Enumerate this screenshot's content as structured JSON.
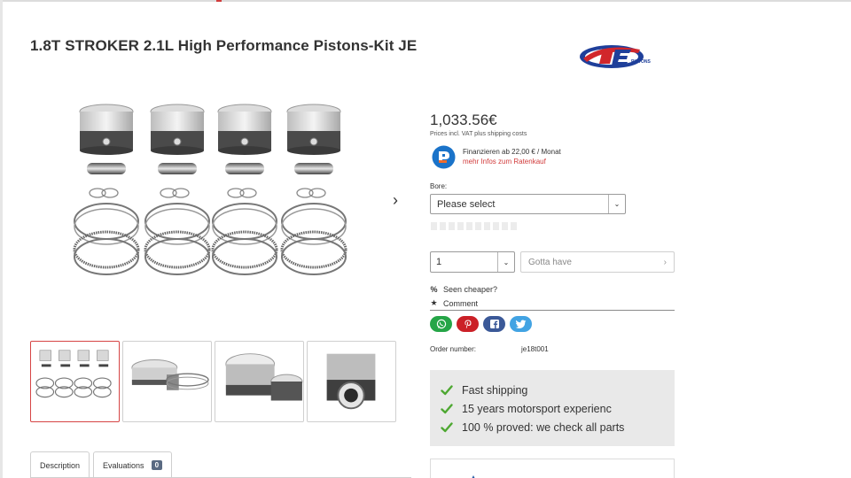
{
  "product": {
    "title": "1.8T STROKER 2.1L High Performance Pistons-Kit JE",
    "price": "1,033.56€",
    "price_note": "Prices incl. VAT plus shipping costs",
    "order_number_label": "Order number:",
    "order_number": "je18t001"
  },
  "brand": {
    "logo_text": "PISTONS"
  },
  "finance": {
    "title": "Finanzieren ab 22,00 € / Monat",
    "link": "mehr Infos zum Ratenkauf"
  },
  "variant": {
    "label": "Bore:",
    "selected": "Please select"
  },
  "quantity": {
    "selected": "1"
  },
  "cart": {
    "button_label": "Gotta have"
  },
  "links": {
    "seen_cheaper_icon": "%",
    "seen_cheaper": "Seen cheaper?",
    "comment": "Comment"
  },
  "share": {
    "icons": [
      "whatsapp-icon",
      "pinterest-icon",
      "facebook-icon",
      "twitter-icon"
    ],
    "colors": {
      "whatsapp": "#25a547",
      "pinterest": "#cb2027",
      "facebook": "#3b5998",
      "twitter": "#42a3e3"
    }
  },
  "features": [
    "Fast shipping",
    "15 years motorsport experienc",
    "100 % proved: we check all parts"
  ],
  "tabs": {
    "description": "Description",
    "evaluations": "Evaluations",
    "evaluations_count": "0"
  },
  "colors": {
    "accent_red": "#d13b3b",
    "check_green": "#4ea832",
    "text": "#333333",
    "feature_bg": "#e9e9e9"
  }
}
